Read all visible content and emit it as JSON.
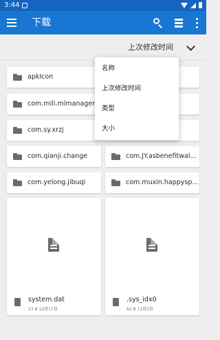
{
  "status_bar": {
    "time": "3:44"
  },
  "app_bar": {
    "title": "下载"
  },
  "sort_bar": {
    "label": "上次修改时间"
  },
  "sort_menu": {
    "items": [
      "名称",
      "上次修改时间",
      "类型",
      "大小"
    ]
  },
  "folders": [
    {
      "name": "apkIcon"
    },
    {
      "name": "com.mili.mlmanager"
    },
    {
      "name": "com.sy.xrzj"
    },
    {
      "name": "com.qianji.change"
    },
    {
      "name": "com.JY.asbenefitwal..."
    },
    {
      "name": "com.yelong.jibuqi"
    },
    {
      "name": "com.muxin.happysp..."
    }
  ],
  "files": [
    {
      "name": "system.dat",
      "meta": "23 B 12月17日"
    },
    {
      "name": ".sys_idx0",
      "meta": "62 B 12月5日"
    }
  ],
  "colors": {
    "status_bar": "#1565c0",
    "app_bar": "#1976d2",
    "background": "#eeeeee",
    "card": "#ffffff",
    "icon_gray": "#6b6b6b"
  },
  "icons": {
    "menu": "hamburger-menu-icon",
    "search": "search-icon",
    "view": "list-view-icon",
    "more": "more-vert-icon",
    "sort": "chevron-down-icon",
    "folder": "folder-icon",
    "file": "file-icon"
  }
}
